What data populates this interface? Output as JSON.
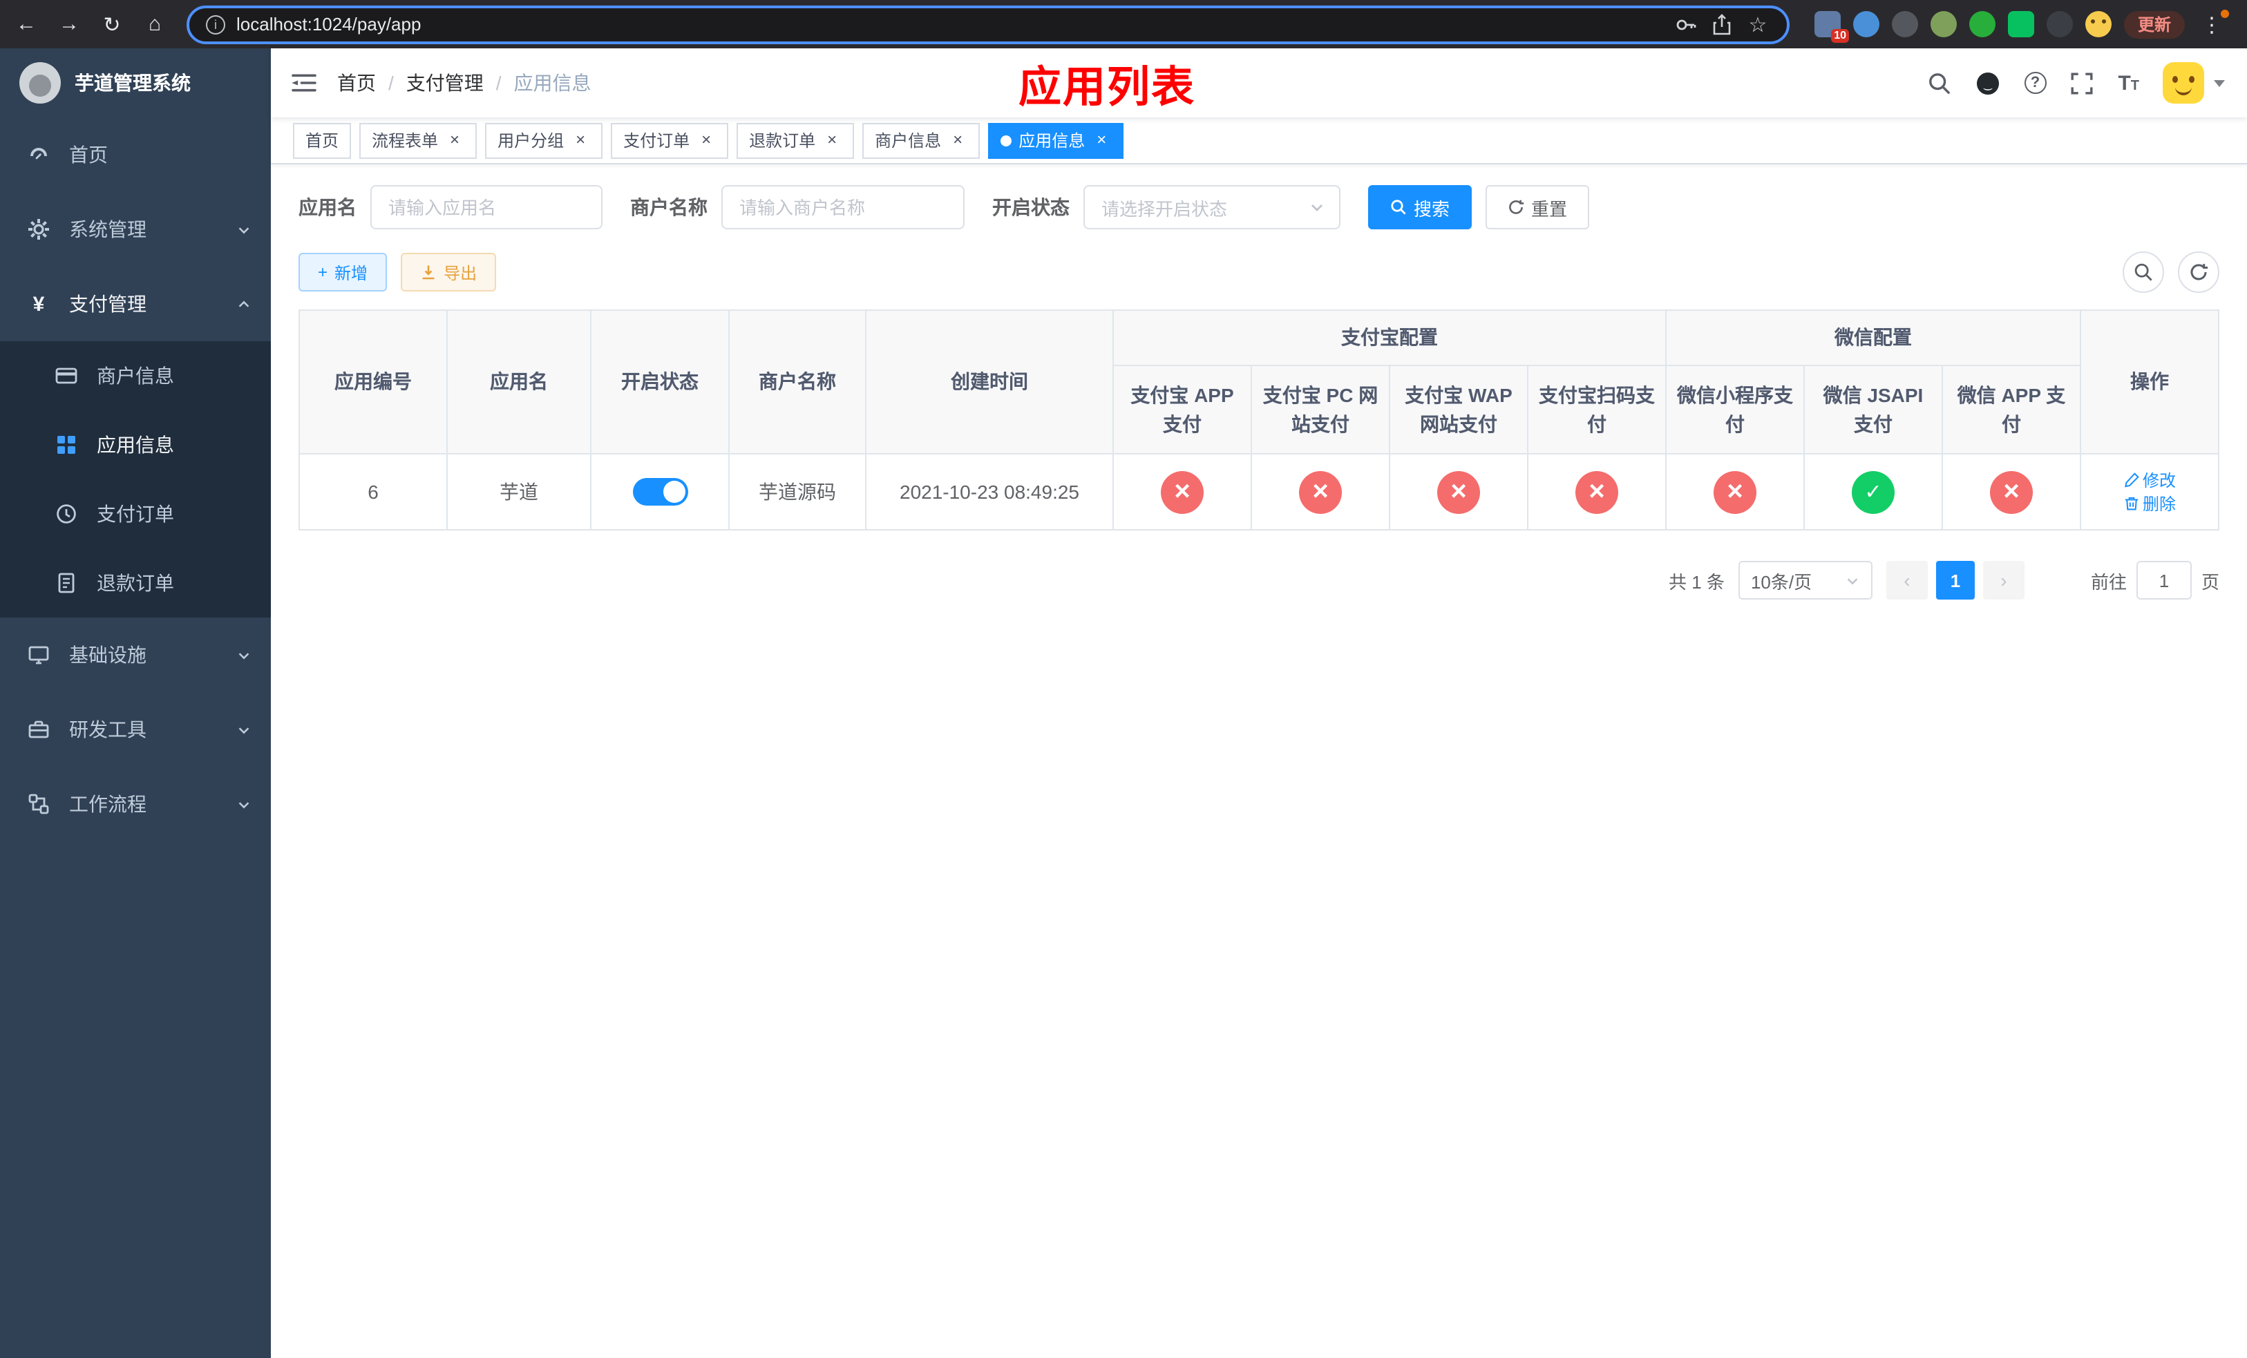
{
  "colors": {
    "primary": "#1890ff",
    "success": "#13ce66",
    "danger": "#f56c6c",
    "sidebar_bg": "#304156",
    "submenu_bg": "#1f2d3d",
    "annotation_red": "#fe0000"
  },
  "browser": {
    "url": "localhost:1024/pay/app",
    "update_label": "更新",
    "extension_badge": "10"
  },
  "sidebar": {
    "title": "芋道管理系统",
    "items": {
      "home": "首页",
      "system": "系统管理",
      "payment": "支付管理",
      "merchant": "商户信息",
      "app": "应用信息",
      "pay_order": "支付订单",
      "refund_order": "退款订单",
      "infra": "基础设施",
      "dev_tools": "研发工具",
      "workflow": "工作流程"
    }
  },
  "navbar": {
    "breadcrumb": {
      "home": "首页",
      "section": "支付管理",
      "current": "应用信息"
    },
    "annotation": "应用列表"
  },
  "tabs": [
    {
      "label": "首页"
    },
    {
      "label": "流程表单"
    },
    {
      "label": "用户分组"
    },
    {
      "label": "支付订单"
    },
    {
      "label": "退款订单"
    },
    {
      "label": "商户信息"
    },
    {
      "label": "应用信息"
    }
  ],
  "filters": {
    "app_name": {
      "label": "应用名",
      "placeholder": "请输入应用名"
    },
    "merchant_name": {
      "label": "商户名称",
      "placeholder": "请输入商户名称"
    },
    "status": {
      "label": "开启状态",
      "placeholder": "请选择开启状态"
    },
    "search": "搜索",
    "reset": "重置"
  },
  "toolbar": {
    "add": "新增",
    "export": "导出"
  },
  "table": {
    "headers": {
      "app_id": "应用编号",
      "app_name": "应用名",
      "status": "开启状态",
      "merchant": "商户名称",
      "created": "创建时间",
      "alipay_group": "支付宝配置",
      "wechat_group": "微信配置",
      "alipay_app": "支付宝 APP 支付",
      "alipay_pc": "支付宝 PC 网站支付",
      "alipay_wap": "支付宝 WAP 网站支付",
      "alipay_qr": "支付宝扫码支付",
      "wx_mini": "微信小程序支付",
      "wx_jsapi": "微信 JSAPI 支付",
      "wx_app": "微信 APP 支付",
      "actions": "操作"
    },
    "row": {
      "app_id": "6",
      "app_name": "芋道",
      "status_on": true,
      "merchant": "芋道源码",
      "created": "2021-10-23 08:49:25",
      "channels": {
        "alipay_app": false,
        "alipay_pc": false,
        "alipay_wap": false,
        "alipay_qr": false,
        "wx_mini": false,
        "wx_jsapi": true,
        "wx_app": false
      },
      "edit": "修改",
      "delete": "删除"
    }
  },
  "pagination": {
    "total": "共 1 条",
    "page_size": "10条/页",
    "current": "1",
    "goto_label": "前往",
    "goto_value": "1",
    "goto_unit": "页"
  }
}
